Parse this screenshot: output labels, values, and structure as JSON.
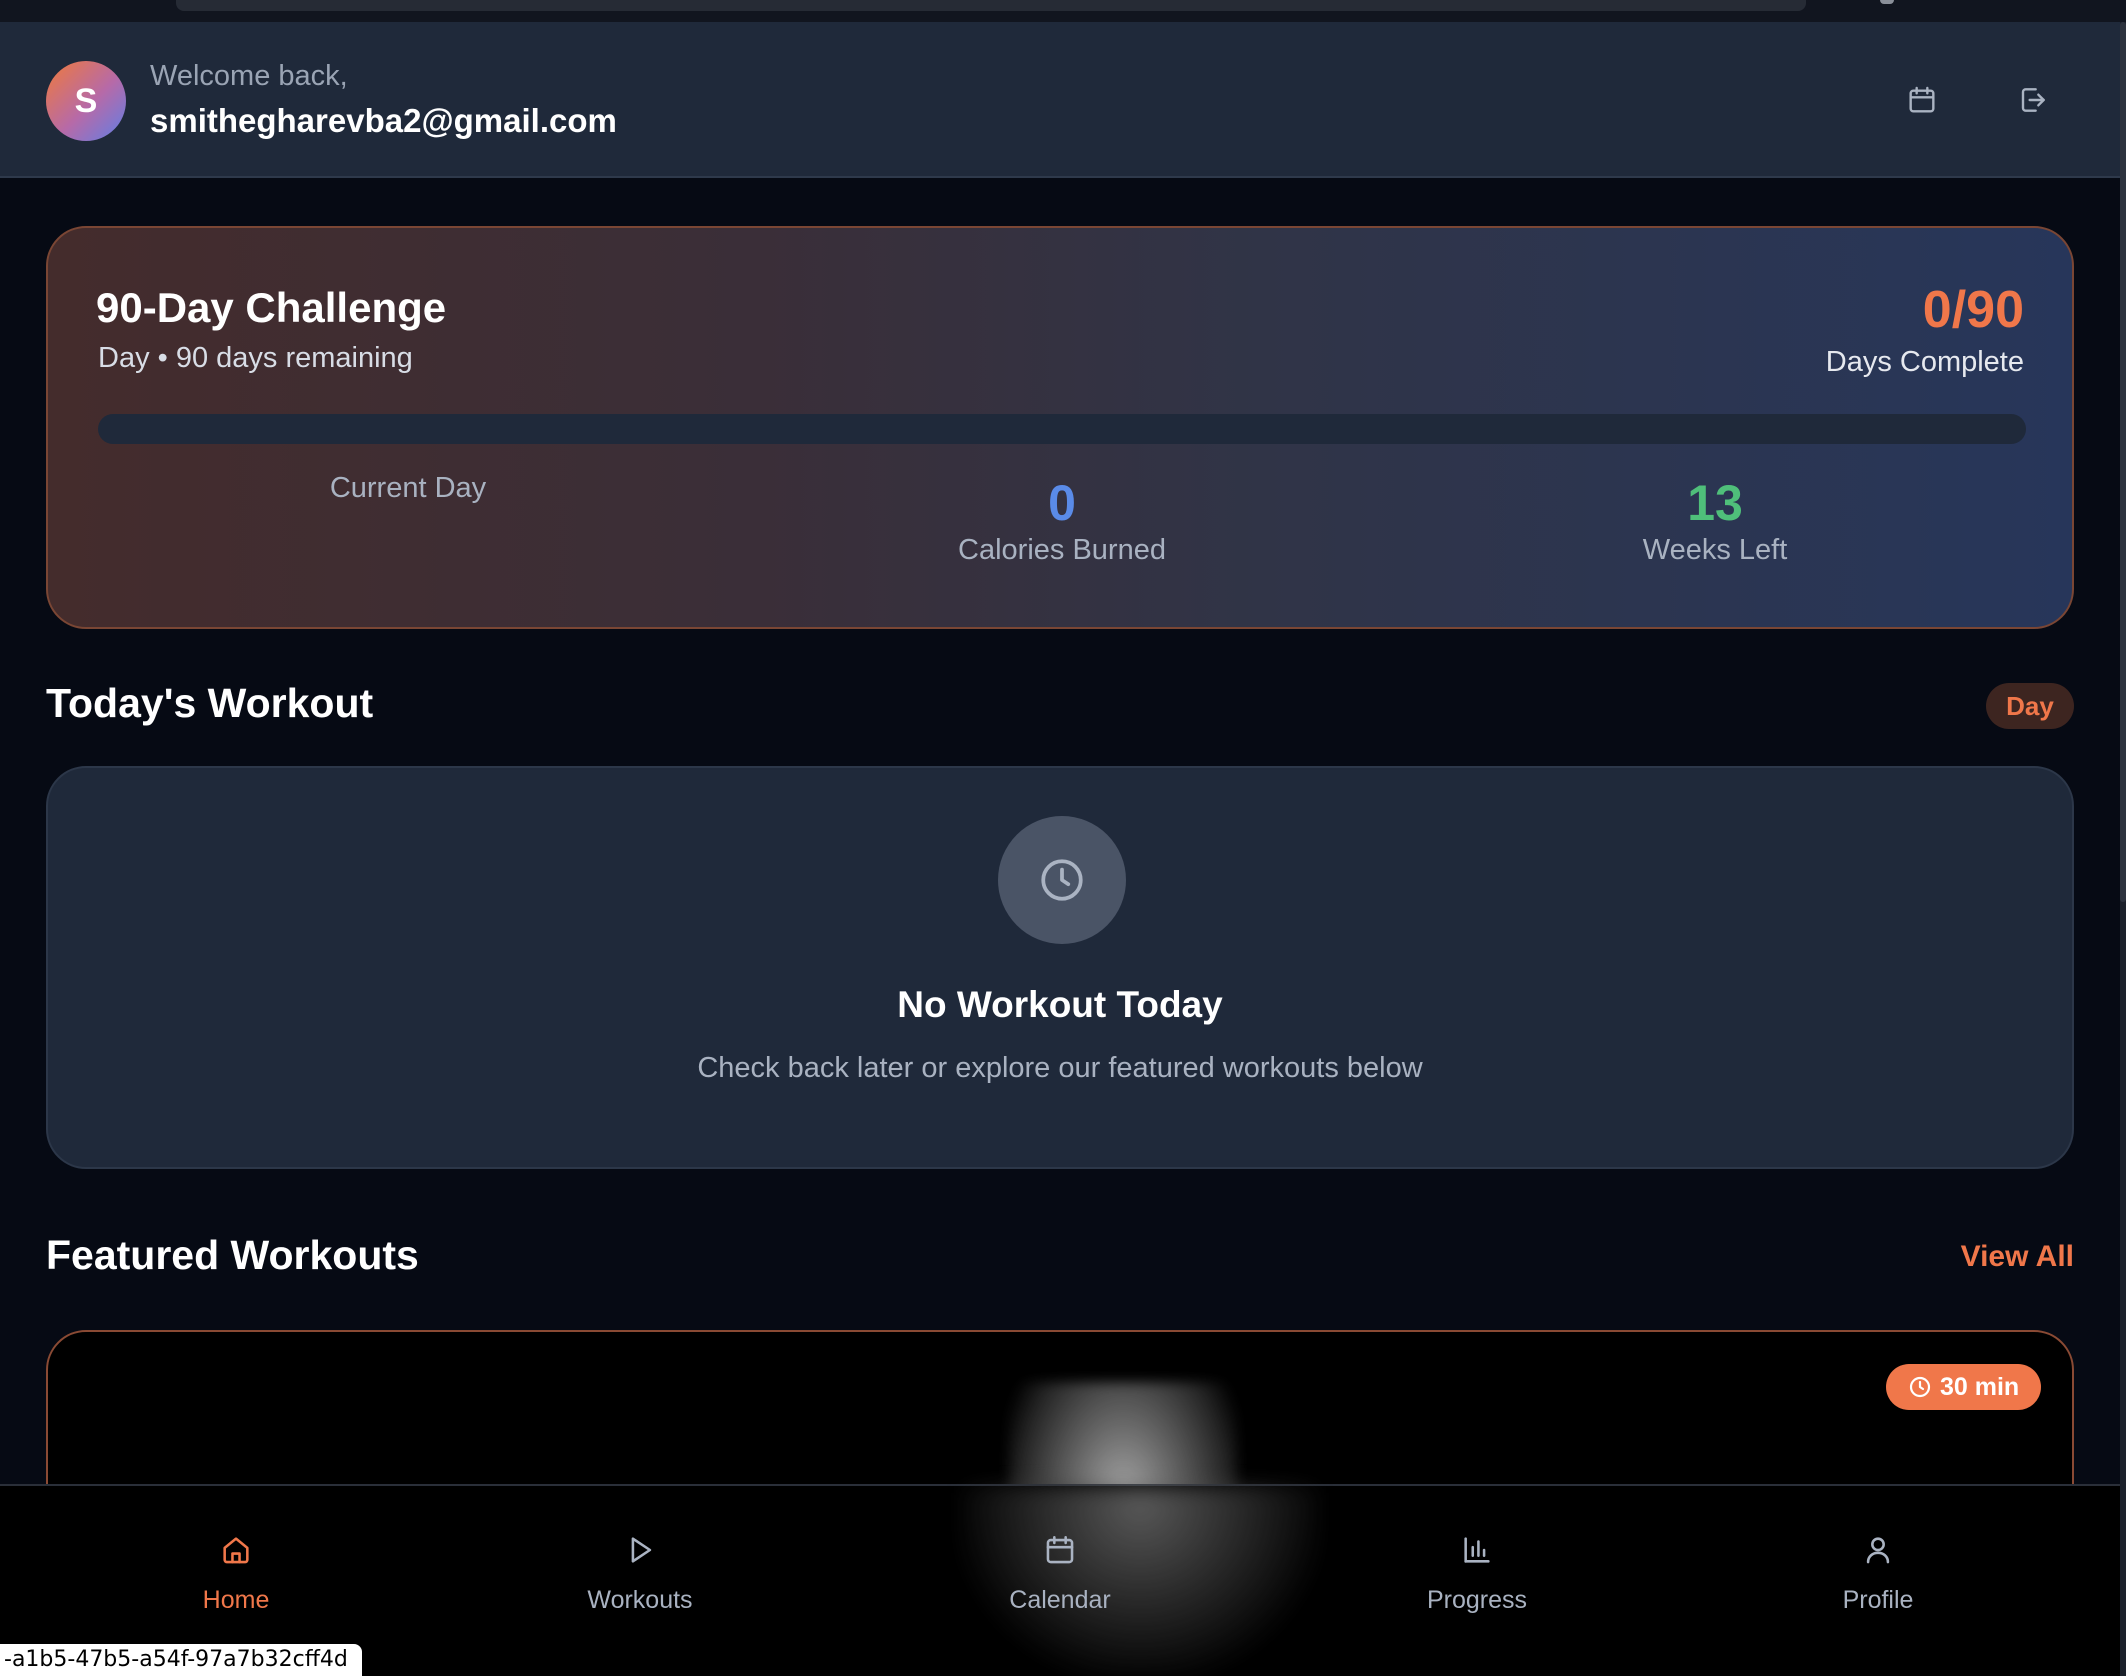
{
  "header": {
    "welcome": "Welcome back,",
    "email": "smithegharevba2@gmail.com",
    "avatar_initial": "S",
    "icons": [
      "calendar-icon",
      "logout-icon"
    ]
  },
  "challenge": {
    "title": "90-Day Challenge",
    "subtitle": "Day • 90 days remaining",
    "count": "0/90",
    "count_label": "Days Complete",
    "progress_fraction": 0,
    "stats": [
      {
        "value": "",
        "label": "Current Day"
      },
      {
        "value": "0",
        "label": "Calories Burned"
      },
      {
        "value": "13",
        "label": "Weeks Left"
      }
    ]
  },
  "today": {
    "section_title": "Today's Workout",
    "badge": "Day",
    "empty_title": "No Workout Today",
    "empty_subtitle": "Check back later or explore our featured workouts below",
    "icon": "clock-icon"
  },
  "featured": {
    "section_title": "Featured Workouts",
    "view_all": "View All",
    "cards": [
      {
        "duration": "30 min"
      }
    ]
  },
  "nav": [
    {
      "label": "Home",
      "icon": "home-icon",
      "active": true
    },
    {
      "label": "Workouts",
      "icon": "play-icon",
      "active": false
    },
    {
      "label": "Calendar",
      "icon": "calendar-icon",
      "active": false
    },
    {
      "label": "Progress",
      "icon": "bar-chart-icon",
      "active": false
    },
    {
      "label": "Profile",
      "icon": "user-icon",
      "active": false
    }
  ],
  "status_url": "-a1b5-47b5-a54f-97a7b32cff4d",
  "colors": {
    "accent": "#f0774a",
    "blue": "#5a8be8",
    "green": "#4fbf7a",
    "background": "#060a14",
    "card": "#1f293a"
  }
}
